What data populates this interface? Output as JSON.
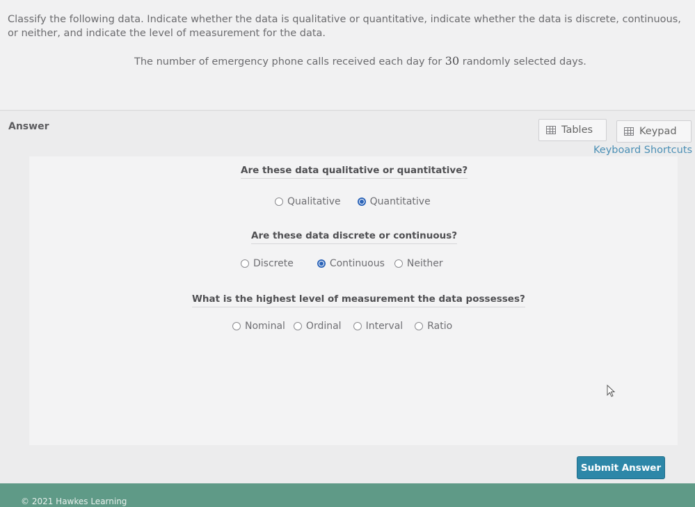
{
  "question": {
    "instructions": "Classify the following data. Indicate whether the data is qualitative or quantitative, indicate whether the data is discrete, continuous, or neither, and indicate the level of measurement for the data.",
    "prompt_before": "The number of emergency phone calls received each day for ",
    "prompt_number": "30",
    "prompt_after": " randomly selected days."
  },
  "answer": {
    "label": "Answer",
    "tables_label": "Tables",
    "keypad_label": "Keypad",
    "shortcuts_label": "Keyboard Shortcuts",
    "q1": {
      "heading": "Are these data qualitative or quantitative?",
      "options": [
        "Qualitative",
        "Quantitative"
      ],
      "selected": "Quantitative"
    },
    "q2": {
      "heading": "Are these data discrete or continuous?",
      "options": [
        "Discrete",
        "Continuous",
        "Neither"
      ],
      "selected": "Continuous"
    },
    "q3": {
      "heading": "What is the highest level of measurement the data possesses?",
      "options": [
        "Nominal",
        "Ordinal",
        "Interval",
        "Ratio"
      ],
      "selected": null
    },
    "submit_label": "Submit Answer",
    "accent_color": "#2a63b8",
    "button_color": "#2d87a8"
  },
  "footer": {
    "copyright": "© 2021 Hawkes Learning"
  }
}
